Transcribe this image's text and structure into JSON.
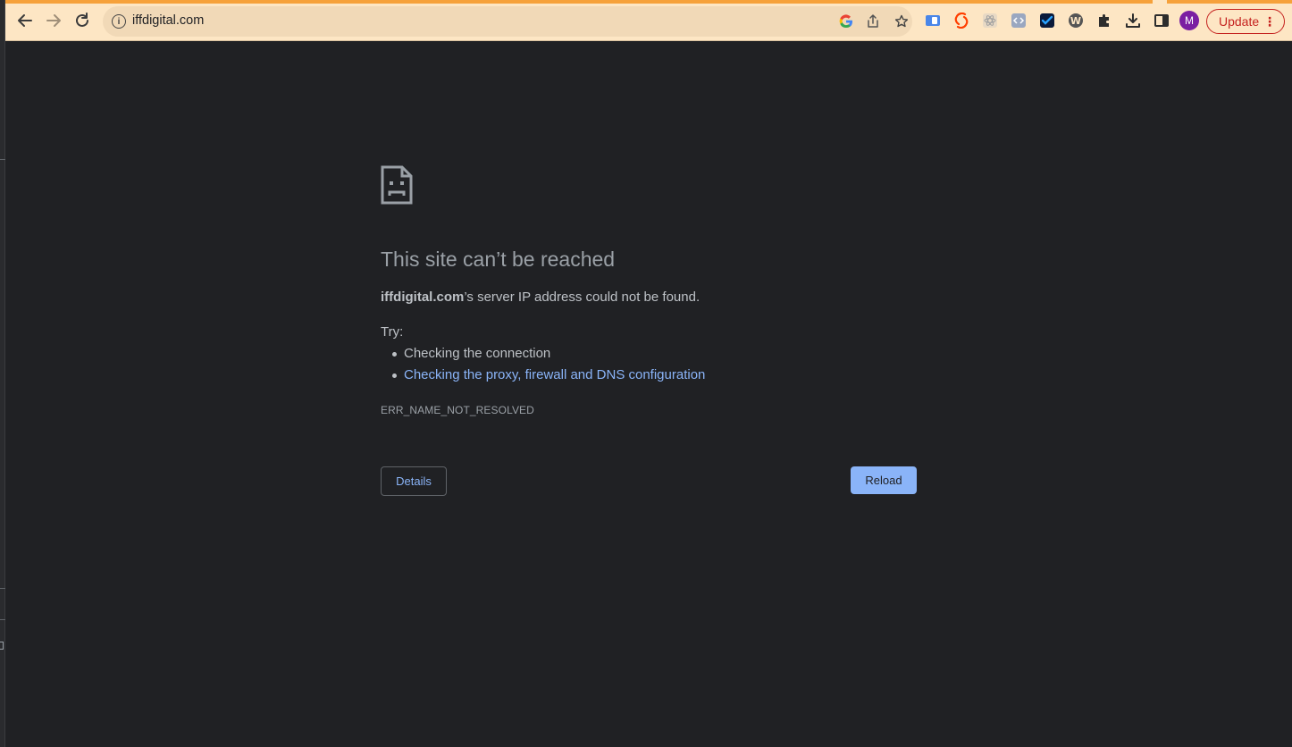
{
  "browser": {
    "url": "iffdigital.com",
    "update_label": "Update",
    "avatar_letter": "M"
  },
  "error": {
    "title": "This site can’t be reached",
    "host": "iffdigital.com",
    "message_suffix": "’s server IP address could not be found.",
    "try_label": "Try:",
    "suggestions": [
      "Checking the connection",
      "Checking the proxy, firewall and DNS configuration"
    ],
    "code": "ERR_NAME_NOT_RESOLVED",
    "details_label": "Details",
    "reload_label": "Reload"
  },
  "icons": {
    "back": "back-arrow-icon",
    "forward": "forward-arrow-icon",
    "reload": "reload-icon",
    "site_info": "info-icon",
    "google": "google-icon",
    "share": "share-icon",
    "bookmark": "star-icon",
    "extensions": "puzzle-icon",
    "downloads": "download-icon",
    "side_panel": "side-panel-icon",
    "menu": "kebab-menu-icon",
    "sad_page": "sad-page-icon"
  },
  "colors": {
    "toolbar": "#fde6c4",
    "omnibox": "#f1d9b7",
    "page_bg": "#202124",
    "link": "#8ab4f8",
    "update": "#c5221f",
    "avatar": "#7b1fa2"
  }
}
